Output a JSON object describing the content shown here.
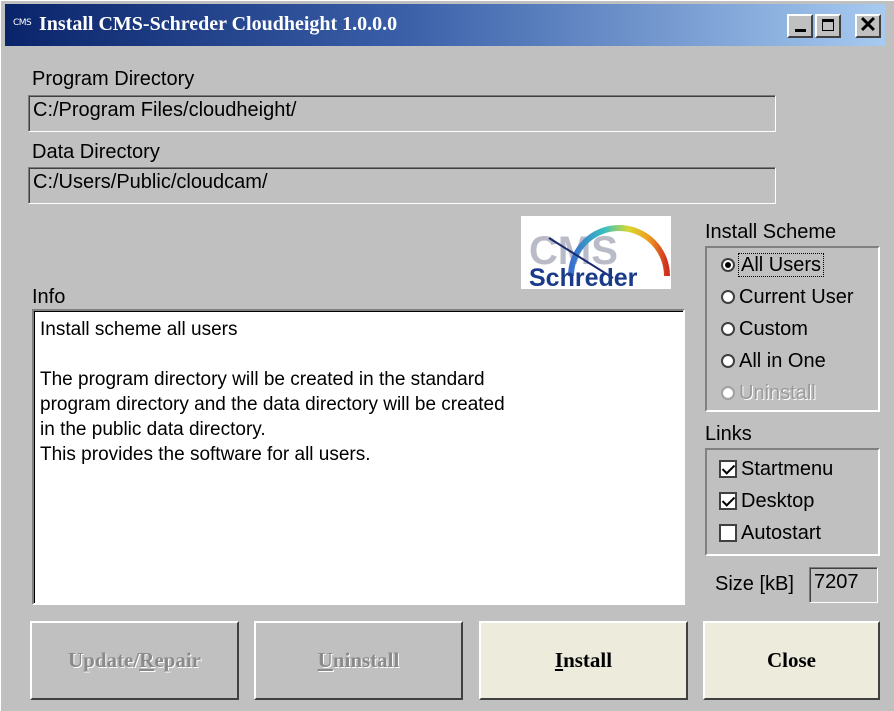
{
  "window": {
    "title": "Install CMS-Schreder Cloudheight 1.0.0.0",
    "icon_text": "CMS",
    "controls": {
      "minimize": "_",
      "maximize": "□",
      "close": "✕"
    }
  },
  "program_directory": {
    "label": "Program Directory",
    "value": "C:/Program Files/cloudheight/"
  },
  "data_directory": {
    "label": "Data Directory",
    "value": "C:/Users/Public/cloudcam/"
  },
  "logo": {
    "top_text": "CMS",
    "bottom_text": "Schreder"
  },
  "info": {
    "label": "Info",
    "text": "Install scheme all users\n\nThe program directory will be created in the standard\nprogram directory and the data directory will be created\nin the public data directory.\nThis provides the software for all users."
  },
  "install_scheme": {
    "label": "Install Scheme",
    "options": [
      {
        "label": "All Users",
        "selected": true,
        "enabled": true
      },
      {
        "label": "Current User",
        "selected": false,
        "enabled": true
      },
      {
        "label": "Custom",
        "selected": false,
        "enabled": true
      },
      {
        "label": "All in One",
        "selected": false,
        "enabled": true
      },
      {
        "label": "Uninstall",
        "selected": false,
        "enabled": false
      }
    ]
  },
  "links": {
    "label": "Links",
    "options": [
      {
        "label": "Startmenu",
        "checked": true
      },
      {
        "label": "Desktop",
        "checked": true
      },
      {
        "label": "Autostart",
        "checked": false
      }
    ]
  },
  "size": {
    "label": "Size [kB]",
    "value": "7207"
  },
  "buttons": {
    "update_repair": {
      "label_pre": "Update/",
      "label_u": "R",
      "label_post": "epair",
      "enabled": false
    },
    "uninstall": {
      "label_pre": "",
      "label_u": "U",
      "label_post": "ninstall",
      "enabled": false
    },
    "install": {
      "label_pre": "",
      "label_u": "I",
      "label_post": "nstall",
      "enabled": true
    },
    "close": {
      "label": "Close",
      "enabled": true
    }
  },
  "colors": {
    "title_start": "#0a246a",
    "title_end": "#a6caf0",
    "face": "#c0c0c0",
    "button_enabled": "#ecebdc"
  }
}
